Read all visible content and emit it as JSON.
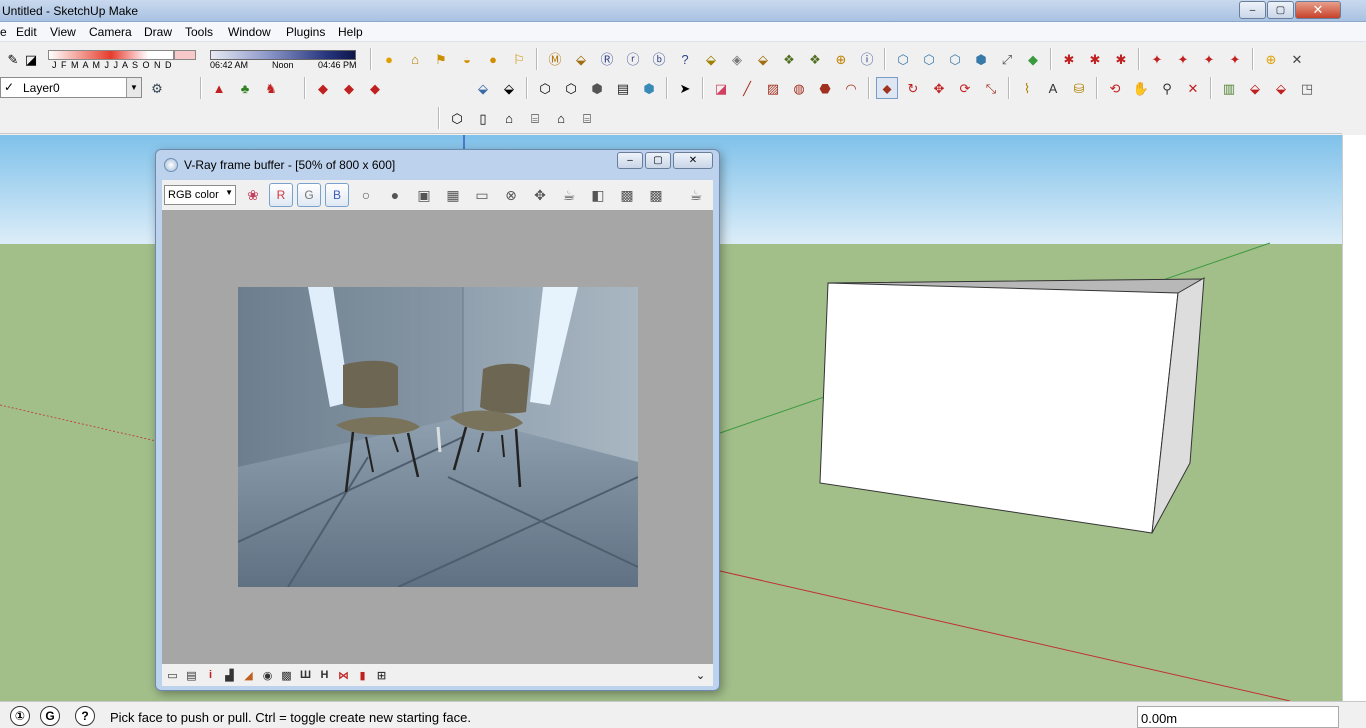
{
  "window": {
    "title": "Untitled - SketchUp Make",
    "minimize": "‒",
    "maximize": "▢",
    "close": "✕"
  },
  "menu": [
    "e",
    "Edit",
    "View",
    "Camera",
    "Draw",
    "Tools",
    "Window",
    "Plugins",
    "Help"
  ],
  "shadow": {
    "months": "J F M A M J J A S O N D",
    "time_start": "06:42 AM",
    "time_mid": "Noon",
    "time_end": "04:46 PM"
  },
  "layer": {
    "current": "Layer0"
  },
  "vray": {
    "title": "V-Ray frame buffer - [50% of 800 x 600]",
    "channel": "RGB color",
    "r": "R",
    "g": "G",
    "b": "B",
    "minimize": "‒",
    "maximize": "▢",
    "close": "✕"
  },
  "status": {
    "message": "Pick face to push or pull.  Ctrl = toggle create new starting face.",
    "measurement": "0.00m"
  },
  "colors": {
    "sky_top": "#7fc1ea",
    "ground": "#a2bf8a",
    "box_face": "#ffffff"
  }
}
